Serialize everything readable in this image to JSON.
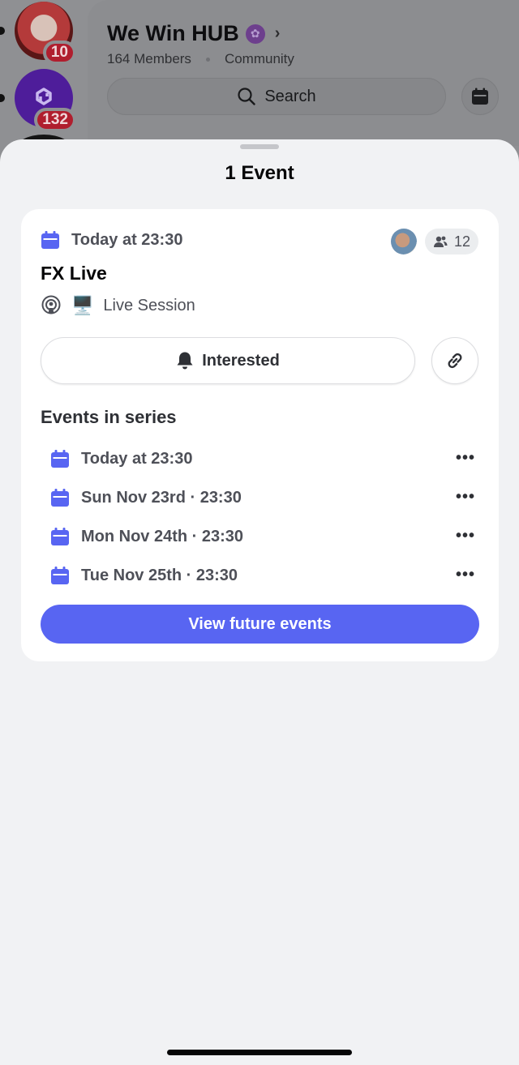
{
  "background": {
    "guild": {
      "name": "We Win HUB",
      "members": "164 Members",
      "type": "Community"
    },
    "search": {
      "label": "Search"
    },
    "servers": [
      {
        "badge": "10"
      },
      {
        "badge": "132"
      }
    ]
  },
  "sheet": {
    "title": "1 Event",
    "event": {
      "when": "Today at 23:30",
      "attendee_count": "12",
      "name": "FX Live",
      "location_emoji": "🖥️",
      "location": "Live Session",
      "interested_label": "Interested"
    },
    "series": {
      "heading": "Events in series",
      "items": [
        {
          "label": "Today at 23:30"
        },
        {
          "label": "Sun Nov 23rd · 23:30"
        },
        {
          "label": "Mon Nov 24th · 23:30"
        },
        {
          "label": "Tue Nov 25th · 23:30"
        }
      ],
      "more_glyph": "•••"
    },
    "cta_label": "View future events"
  },
  "colors": {
    "accent": "#5865f2",
    "calendar_icon": "#5865f2",
    "badge": "#b01e2e"
  }
}
